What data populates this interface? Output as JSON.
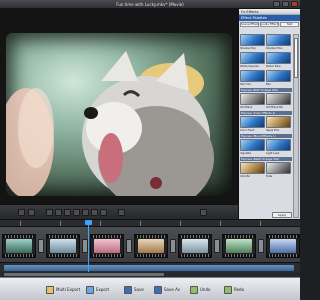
{
  "window": {
    "title": "Fun time with Lucky.mkv* (Movie)"
  },
  "panel": {
    "header": "Fx Effects",
    "subheader": "Effect Palettes",
    "tabs": [
      "Scene Effect",
      "Audio Effect",
      "Text"
    ],
    "groups": [
      "Express (B/W Vintage 60s)",
      "Express (Color Effects 1)",
      "Express (Mood Effects 1)",
      "Express (B&W Vintage 50s)"
    ],
    "items": [
      "Shadow Box",
      "Shadow Plus",
      "White Squares",
      "Poster Blue",
      "Silk Fold",
      "Blur",
      "Old Black",
      "Old Black BG",
      "Color Flash",
      "Sepia Film",
      "Vignette",
      "Light Leak",
      "Colorful",
      "Fade"
    ],
    "apply_label": "Apply"
  },
  "playback": {
    "buttons": [
      "prev-frame",
      "play",
      "pause",
      "stop",
      "next-frame",
      "rewind",
      "fast-forward",
      "loop",
      "fullscreen"
    ]
  },
  "timeline": {
    "clip_count": 8
  },
  "toolbar": {
    "buttons": [
      {
        "label": "Multi Export",
        "icon": "film-export-icon"
      },
      {
        "label": "Export",
        "icon": "export-icon"
      },
      {
        "label": "Save",
        "icon": "save-icon"
      },
      {
        "label": "Save As",
        "icon": "save-as-icon"
      },
      {
        "label": "Undo",
        "icon": "undo-icon"
      },
      {
        "label": "Redo",
        "icon": "redo-icon"
      }
    ]
  },
  "colors": {
    "accent": "#3ea3ff",
    "panel_header": "#2a5ea8"
  }
}
